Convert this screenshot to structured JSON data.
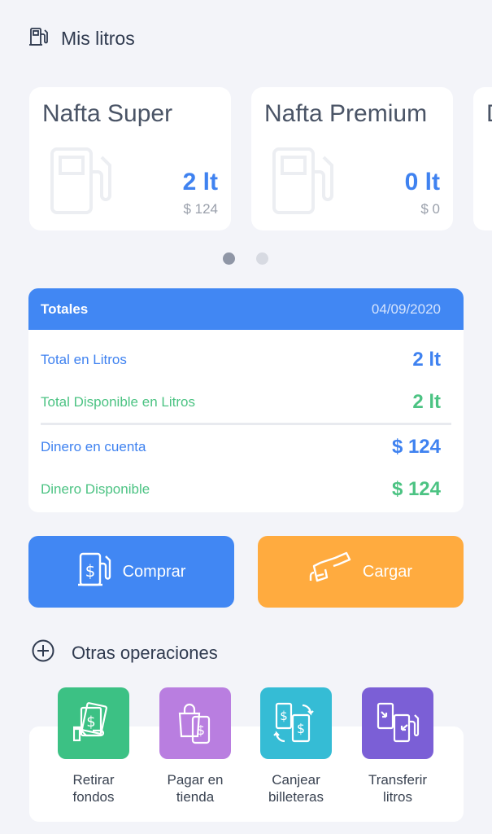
{
  "header": {
    "title": "Mis litros",
    "icon": "fuel-pump-icon"
  },
  "fuel_cards": [
    {
      "name": "Nafta Super",
      "liters": "2 lt",
      "money": "$ 124"
    },
    {
      "name": "Nafta Premium",
      "liters": "0 lt",
      "money": "$ 0"
    },
    {
      "name": "D",
      "liters": "",
      "money": ""
    }
  ],
  "carousel": {
    "pages": 2,
    "active": 1
  },
  "totals": {
    "label": "Totales",
    "date": "04/09/2020",
    "rows": [
      {
        "key": "Total en Litros",
        "value": "2 lt"
      },
      {
        "key": "Total Disponible en Litros",
        "value": "2 lt"
      },
      {
        "key": "Dinero en cuenta",
        "value": "$ 124"
      },
      {
        "key": "Dinero Disponible",
        "value": "$ 124"
      }
    ]
  },
  "actions": {
    "buy": "Comprar",
    "load": "Cargar"
  },
  "other_ops": {
    "title": "Otras operaciones",
    "items": [
      {
        "line1": "Retirar",
        "line2": "fondos",
        "color": "#3cc184",
        "icon": "cash-hand-icon"
      },
      {
        "line1": "Pagar en",
        "line2": "tienda",
        "color": "#b97ee0",
        "icon": "shopping-bag-phone-icon"
      },
      {
        "line1": "Canjear",
        "line2": "billeteras",
        "color": "#35bcd5",
        "icon": "exchange-wallets-icon"
      },
      {
        "line1": "Transferir",
        "line2": "litros",
        "color": "#7b5fd6",
        "icon": "transfer-pumps-icon"
      }
    ]
  },
  "colors": {
    "primary": "#4187f3",
    "accent": "#ffab3f",
    "green": "#4cc383",
    "background": "#f3f4f9"
  }
}
